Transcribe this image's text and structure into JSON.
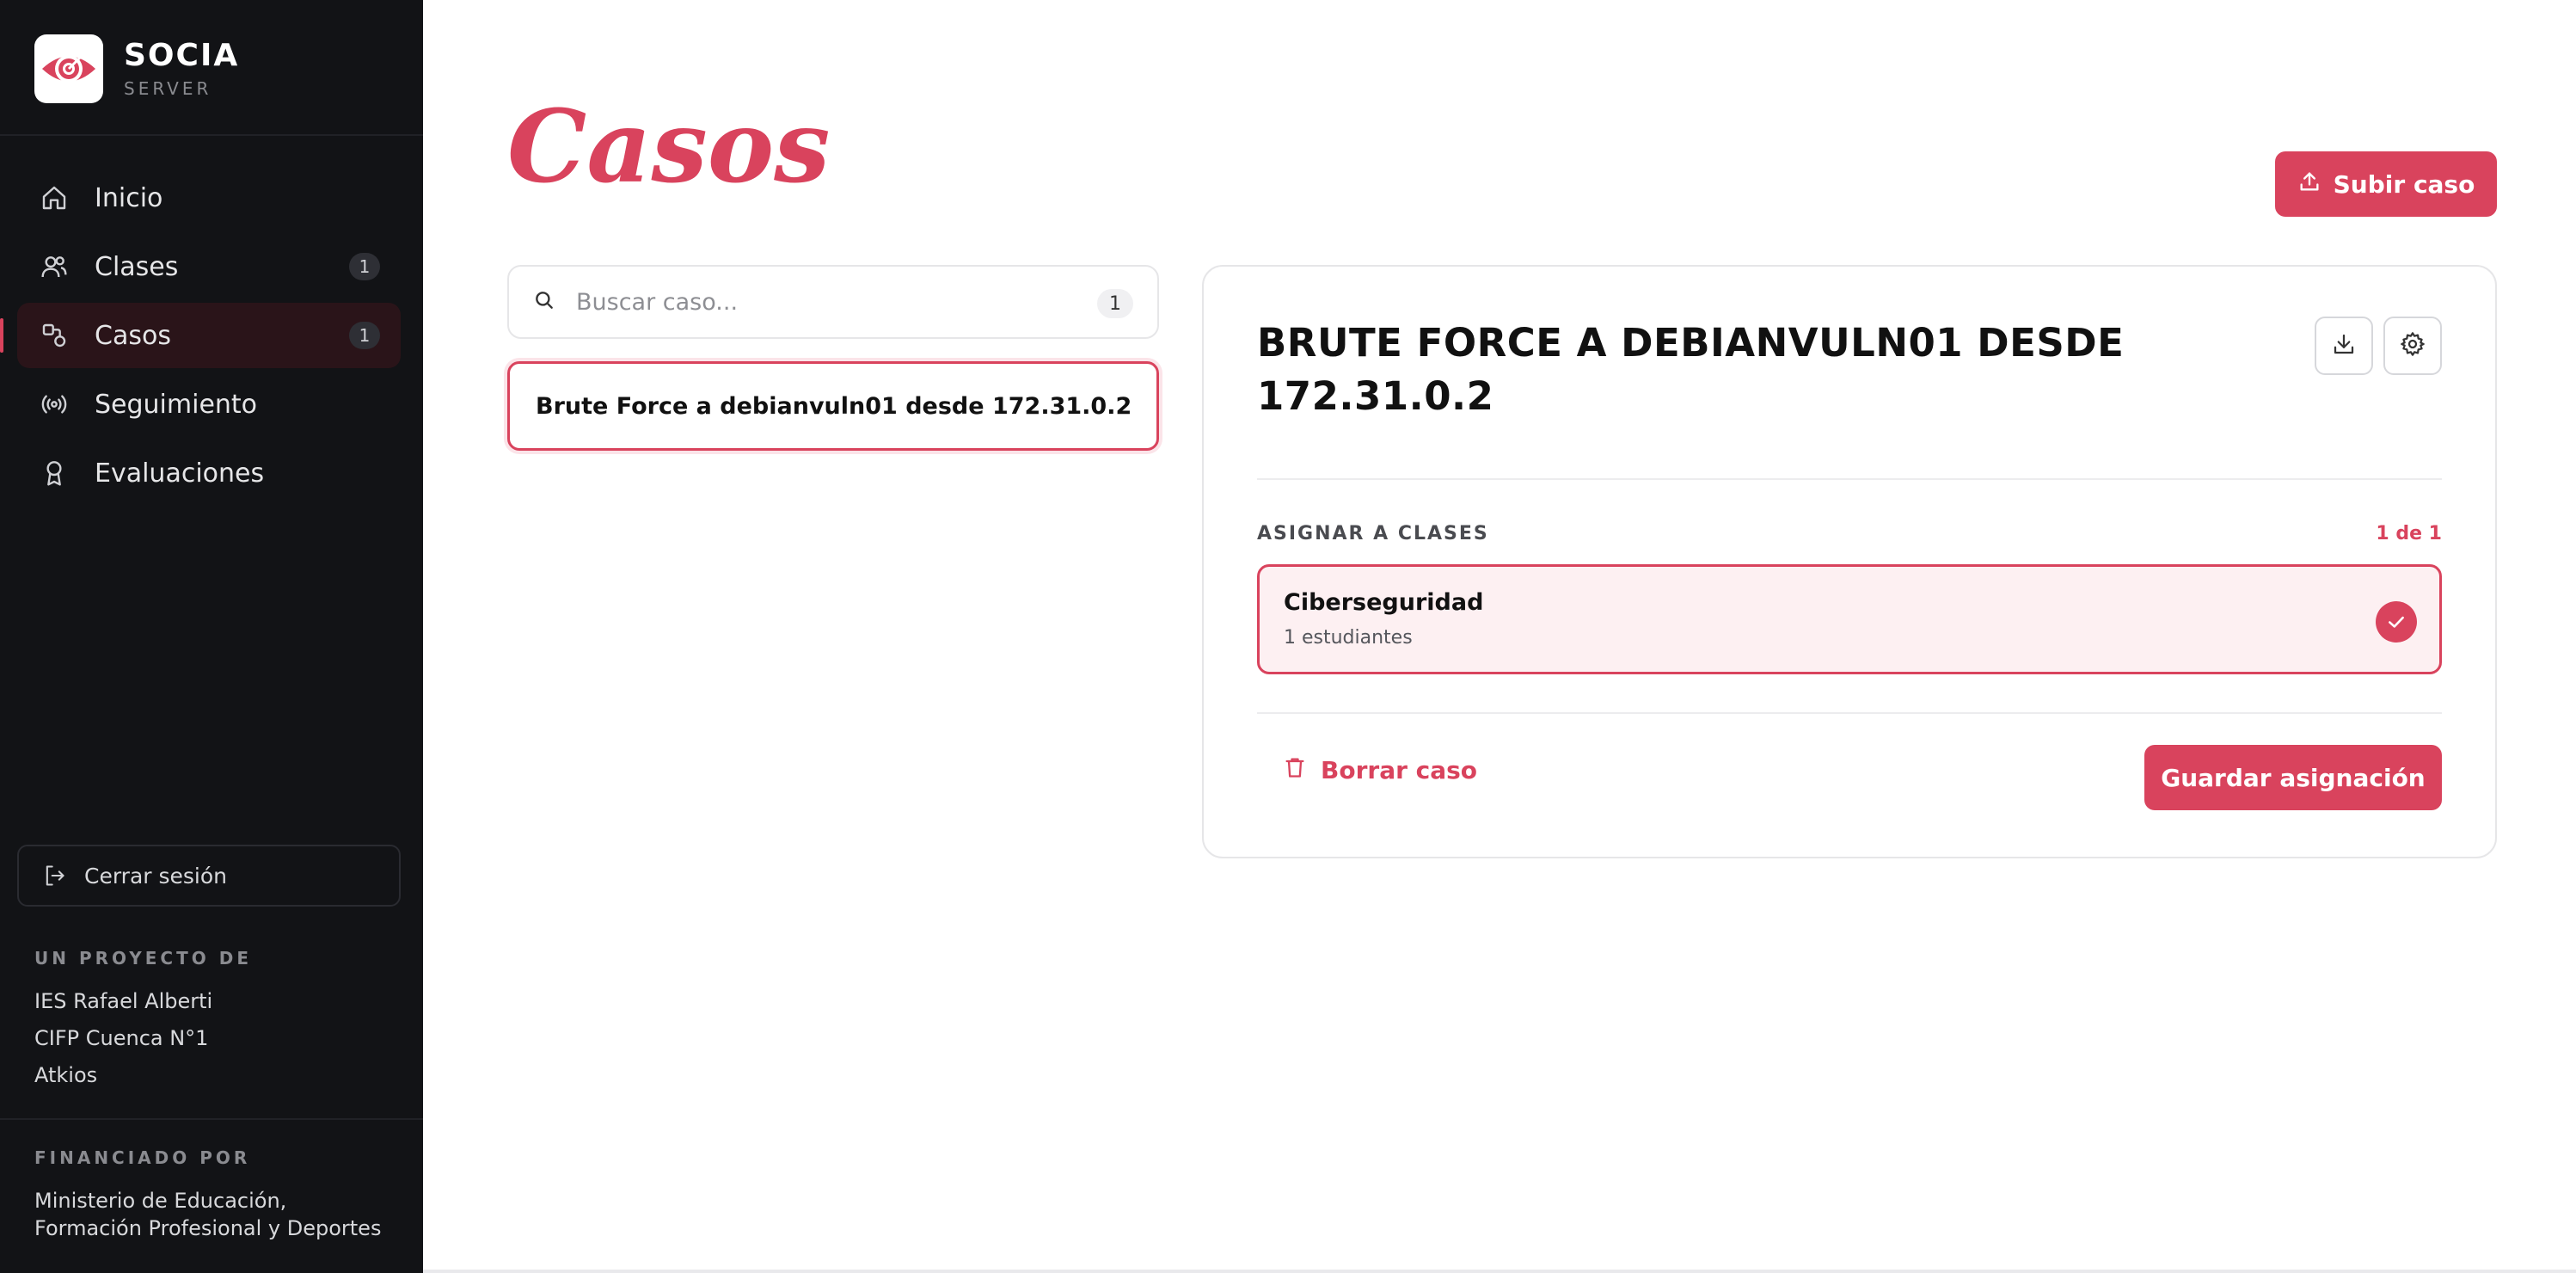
{
  "brand": {
    "name": "SOCIA",
    "subtitle": "SERVER"
  },
  "nav": {
    "items": [
      {
        "label": "Inicio",
        "icon": "home-icon"
      },
      {
        "label": "Clases",
        "icon": "users-icon",
        "badge": "1"
      },
      {
        "label": "Casos",
        "icon": "shapes-icon",
        "badge": "1",
        "active": true
      },
      {
        "label": "Seguimiento",
        "icon": "radio-broadcast-icon"
      },
      {
        "label": "Evaluaciones",
        "icon": "award-icon"
      }
    ]
  },
  "sidebar_footer": {
    "logout_label": "Cerrar sesión",
    "project_heading": "UN PROYECTO DE",
    "project_lines": [
      "IES Rafael Alberti",
      "CIFP Cuenca N°1",
      "Atkios"
    ],
    "funded_heading": "FINANCIADO POR",
    "funded_lines": [
      "Ministerio de Educación,",
      "Formación Profesional y Deportes"
    ]
  },
  "page": {
    "title": "Casos",
    "upload_label": "Subir caso"
  },
  "search": {
    "placeholder": "Buscar caso...",
    "value": "",
    "count": "1"
  },
  "cases": [
    {
      "title": "Brute Force a debianvuln01 desde 172.31.0.2",
      "selected": true
    }
  ],
  "detail": {
    "title_line1": "BRUTE FORCE A DEBIANVULN01 DESDE",
    "title_line2": "172.31.0.2",
    "assign_heading": "ASIGNAR A CLASES",
    "assign_count": "1 de 1",
    "classes": [
      {
        "name": "Ciberseguridad",
        "students": "1 estudiantes",
        "checked": true
      }
    ],
    "delete_label": "Borrar caso",
    "save_label": "Guardar asignación"
  },
  "colors": {
    "accent": "#d9435d",
    "sidebar_bg": "#121316",
    "active_bg": "#2a1419",
    "card_bg": "#fdf0f2"
  }
}
